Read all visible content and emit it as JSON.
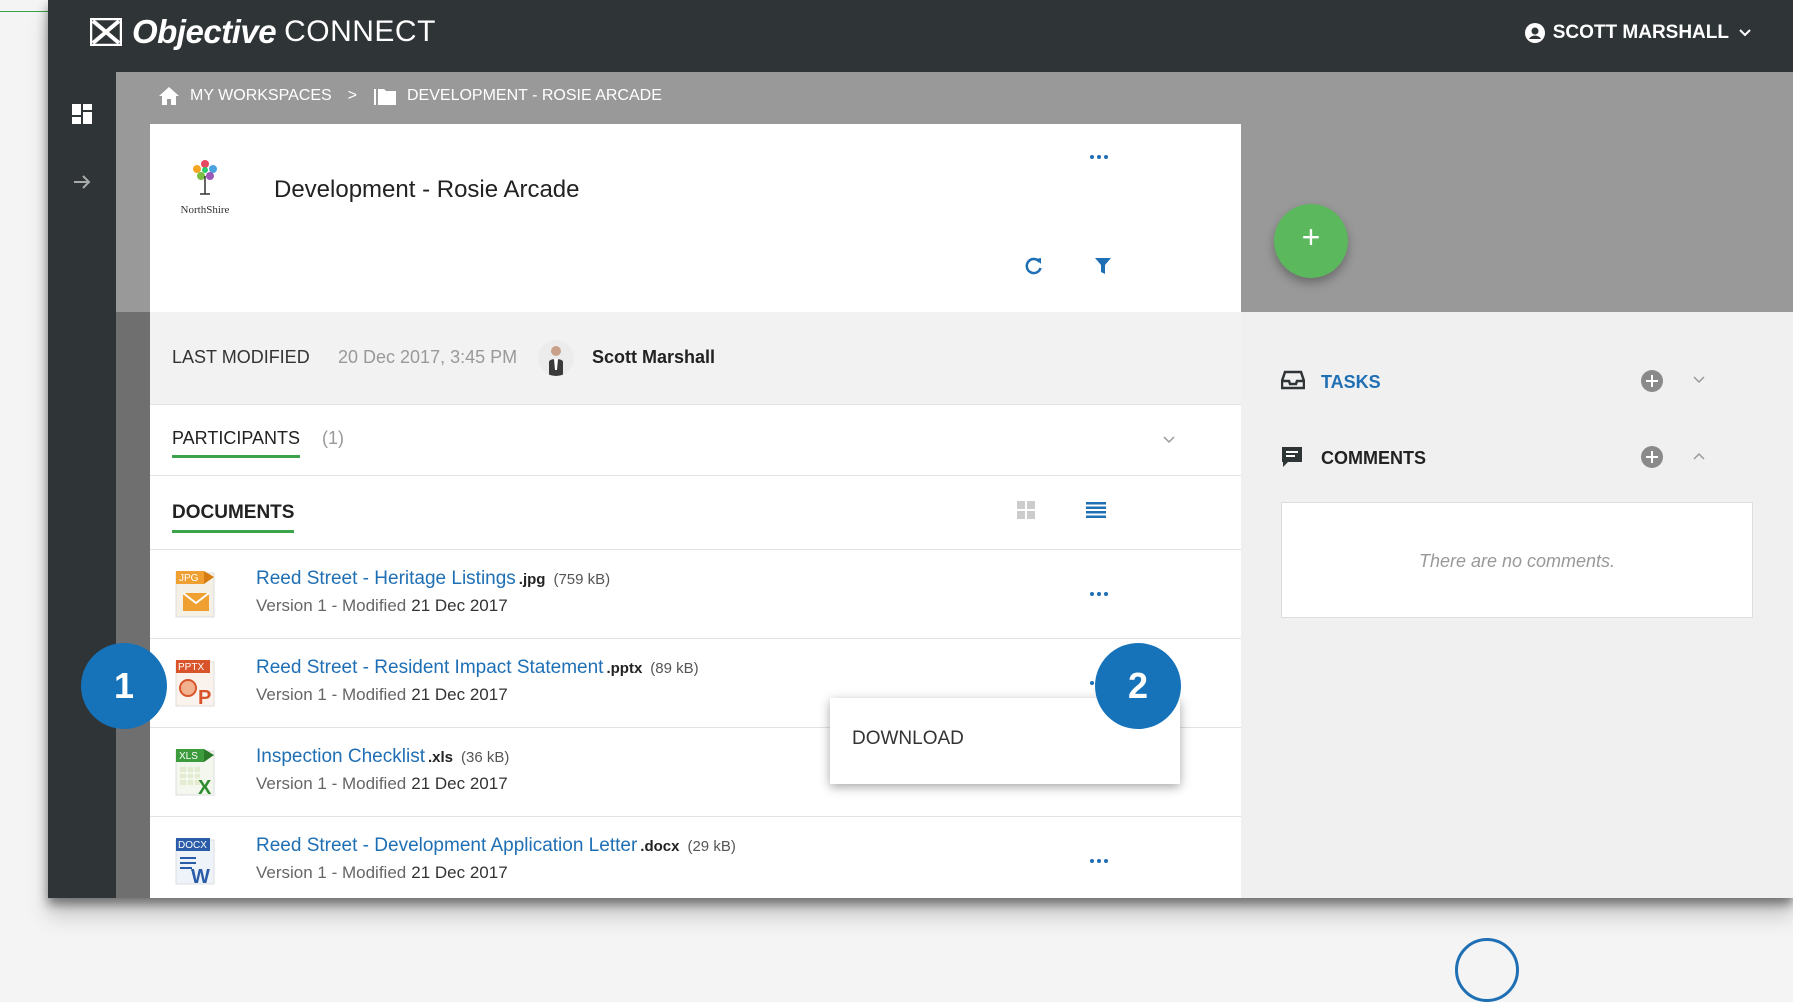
{
  "app": {
    "brand": "Objective",
    "product": "CONNECT"
  },
  "user": {
    "name": "SCOTT MARSHALL"
  },
  "breadcrumb": {
    "home": "MY WORKSPACES",
    "separator": ">",
    "current": "DEVELOPMENT - ROSIE ARCADE"
  },
  "workspace": {
    "title": "Development - Rosie Arcade",
    "logo_text": "NorthShire"
  },
  "last_modified": {
    "label": "LAST MODIFIED",
    "date": "20 Dec 2017, 3:45 PM",
    "user": "Scott Marshall"
  },
  "participants": {
    "label": "PARTICIPANTS",
    "count": "(1)"
  },
  "documents": {
    "label": "DOCUMENTS",
    "items": [
      {
        "name": "Reed Street - Heritage Listings",
        "ext": ".jpg",
        "size": "(759 kB)",
        "meta": "Version 1 - Modified",
        "date": "21 Dec 2017",
        "icon_label": "JPG"
      },
      {
        "name": "Reed Street - Resident Impact Statement",
        "ext": ".pptx",
        "size": "(89 kB)",
        "meta": "Version 1 - Modified",
        "date": "21 Dec 2017",
        "icon_label": "PPTX"
      },
      {
        "name": "Inspection Checklist",
        "ext": ".xls",
        "size": "(36 kB)",
        "meta": "Version 1 - Modified",
        "date": "21 Dec 2017",
        "icon_label": "XLS"
      },
      {
        "name": "Reed Street - Development Application Letter",
        "ext": ".docx",
        "size": "(29 kB)",
        "meta": "Version 1 - Modified",
        "date": "21 Dec 2017",
        "icon_label": "DOCX"
      }
    ]
  },
  "context_menu": {
    "download": "DOWNLOAD"
  },
  "sidebar": {
    "tasks_label": "TASKS",
    "comments_label": "COMMENTS",
    "no_comments": "There are no comments."
  },
  "fab": {
    "label": "+"
  },
  "callouts": [
    "1",
    "2"
  ],
  "colors": {
    "link_blue": "#1f6fb5",
    "accent_green": "#3ba34a",
    "fab_green": "#5bb85d",
    "header_dark": "#2f3437",
    "callout_blue": "#1672b9"
  }
}
